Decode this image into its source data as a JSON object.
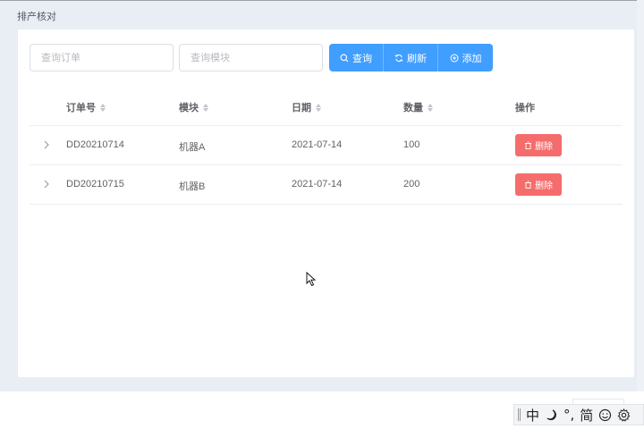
{
  "breadcrumb": "排产核对",
  "filters": {
    "order_placeholder": "查询订单",
    "module_placeholder": "查询模块"
  },
  "toolbar": {
    "search_label": "查询",
    "refresh_label": "刷新",
    "add_label": "添加"
  },
  "table": {
    "headers": [
      "订单号",
      "模块",
      "日期",
      "数量",
      "操作"
    ],
    "rows": [
      {
        "order": "DD20210714",
        "module": "机器A",
        "date": "2021-07-14",
        "qty": "100",
        "action": "删除"
      },
      {
        "order": "DD20210715",
        "module": "机器B",
        "date": "2021-07-14",
        "qty": "200",
        "action": "删除"
      }
    ]
  },
  "ime_bar": {
    "mode": "中",
    "punct": "°,",
    "charset": "简"
  },
  "colors": {
    "primary": "#409eff",
    "danger": "#f56c6c",
    "background": "#e9edf4"
  }
}
